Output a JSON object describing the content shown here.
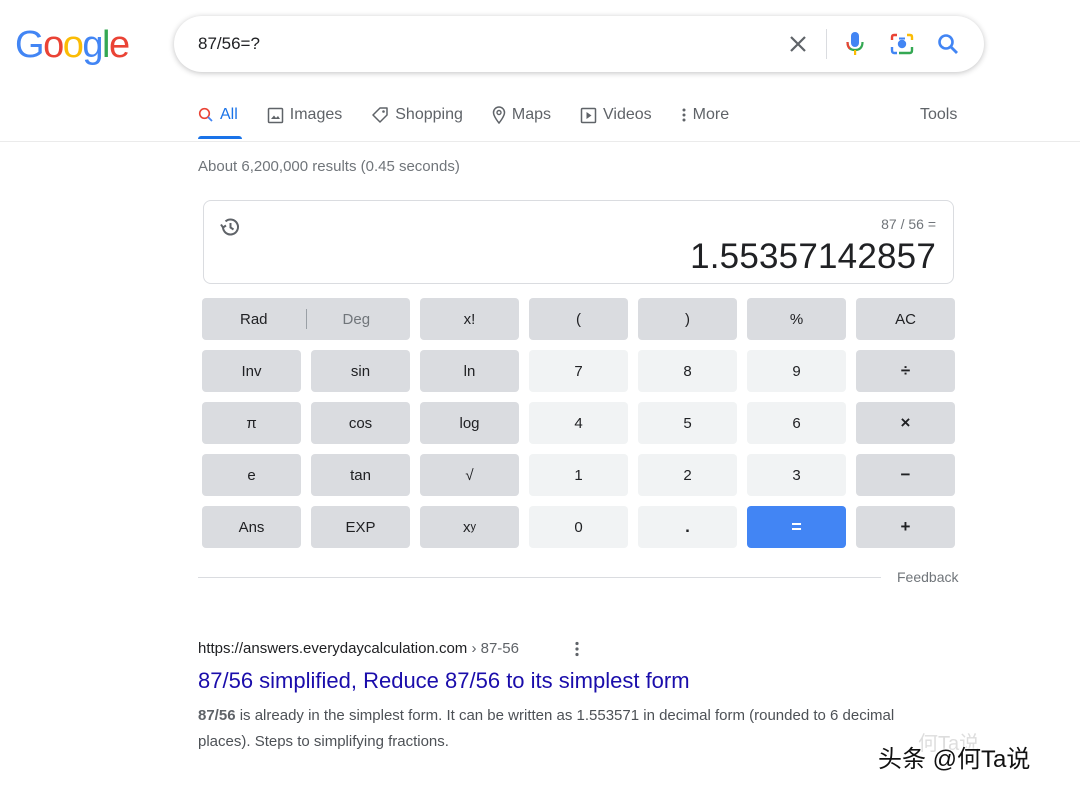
{
  "logo": {
    "letters": [
      "G",
      "o",
      "o",
      "g",
      "l",
      "e"
    ],
    "colors": [
      "#4285f4",
      "#ea4335",
      "#fbbc05",
      "#4285f4",
      "#34a853",
      "#ea4335"
    ]
  },
  "search": {
    "query": "87/56=?",
    "icons": [
      "close-icon",
      "microphone-icon",
      "camera-icon",
      "search-icon"
    ]
  },
  "tabs": [
    {
      "label": "All",
      "icon": "search-icon"
    },
    {
      "label": "Images",
      "icon": "image-icon"
    },
    {
      "label": "Shopping",
      "icon": "tag-icon"
    },
    {
      "label": "Maps",
      "icon": "map-pin-icon"
    },
    {
      "label": "Videos",
      "icon": "play-icon"
    },
    {
      "label": "More",
      "icon": "vertical-dots-icon"
    }
  ],
  "tools_label": "Tools",
  "stats": "About 6,200,000 results (0.45 seconds)",
  "calculator": {
    "expression": "87 / 56 =",
    "result": "1.55357142857",
    "keys": {
      "rad": "Rad",
      "deg": "Deg",
      "fact": "x!",
      "lparen": "(",
      "rparen": ")",
      "percent": "%",
      "ac": "AC",
      "inv": "Inv",
      "sin": "sin",
      "ln": "ln",
      "n7": "7",
      "n8": "8",
      "n9": "9",
      "div": "÷",
      "pi": "π",
      "cos": "cos",
      "log": "log",
      "n4": "4",
      "n5": "5",
      "n6": "6",
      "mul": "×",
      "e": "e",
      "tan": "tan",
      "sqrt": "√",
      "n1": "1",
      "n2": "2",
      "n3": "3",
      "sub": "−",
      "ans": "Ans",
      "exp": "EXP",
      "pow_base": "x",
      "pow_exp": "y",
      "n0": "0",
      "dot": ".",
      "eq": "=",
      "add": "+"
    },
    "feedback": "Feedback"
  },
  "result": {
    "url": "https://answers.everydaycalculation.com",
    "crumb": " › 87-56",
    "title": "87/56 simplified, Reduce 87/56 to its simplest form",
    "snippet_bold": "87/56",
    "snippet_rest": " is already in the simplest form. It can be written as 1.553571 in decimal form (rounded to 6 decimal places). Steps to simplifying fractions."
  },
  "watermark": {
    "text": "头条 @何Ta说",
    "faint": "何Ta说"
  },
  "colors": {
    "accent": "#1a73e8",
    "link": "#1a0dab",
    "equals": "#4285f4"
  }
}
